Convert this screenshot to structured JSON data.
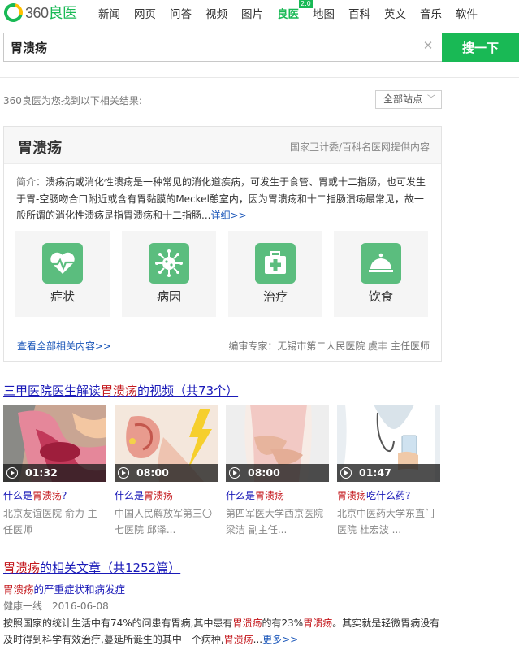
{
  "header": {
    "logo": {
      "num": "360",
      "text": "良医"
    },
    "nav": [
      {
        "label": "新闻",
        "active": false
      },
      {
        "label": "网页",
        "active": false
      },
      {
        "label": "问答",
        "active": false
      },
      {
        "label": "视频",
        "active": false
      },
      {
        "label": "图片",
        "active": false
      },
      {
        "label": "良医",
        "active": true,
        "badge": "2.0"
      },
      {
        "label": "地图",
        "active": false
      },
      {
        "label": "百科",
        "active": false
      },
      {
        "label": "英文",
        "active": false
      },
      {
        "label": "音乐",
        "active": false
      },
      {
        "label": "软件",
        "active": false
      }
    ],
    "search": {
      "value": "胃溃疡",
      "button": "搜一下",
      "clear_icon": "close-icon"
    }
  },
  "results": {
    "info": "360良医为您找到以下相关结果:",
    "site_filter": "全部站点",
    "brand_color": "#19b955"
  },
  "card": {
    "title": "胃溃疡",
    "source": "国家卫计委/百科名医网提供内容",
    "intro_lead": "简介：",
    "intro": "溃疡病或消化性溃疡是一种常见的消化道疾病，可发生于食管、胃或十二指肠，也可发生于胃-空肠吻合口附近或含有胃黏膜的Meckel憩室内，因为胃溃疡和十二指肠溃疡最常见，故一般所谓的消化性溃疡是指胃溃疡和十二指肠...",
    "intro_more": "详细>>",
    "tiles": [
      {
        "label": "症状",
        "icon": "heart-pulse-icon"
      },
      {
        "label": "病因",
        "icon": "virus-icon"
      },
      {
        "label": "治疗",
        "icon": "first-aid-kit-icon"
      },
      {
        "label": "饮食",
        "icon": "food-cloche-icon"
      }
    ],
    "more": "查看全部相关内容>>",
    "experts": "编审专家：无锡市第二人民医院 虞丰 主任医师"
  },
  "videos": {
    "heading_pre": "三甲医院医生解读",
    "heading_hl": "胃溃疡",
    "heading_post": "的视频（共73个）",
    "items": [
      {
        "duration": "01:32",
        "title_pre": "什么是",
        "title_hl": "胃溃疡",
        "title_post": "?",
        "meta": "北京友谊医院 俞力 主任医师"
      },
      {
        "duration": "08:00",
        "title_pre": "什么是",
        "title_hl": "胃溃疡",
        "title_post": "",
        "meta": "中国人民解放军第三〇七医院 邱泽..."
      },
      {
        "duration": "08:00",
        "title_pre": "什么是",
        "title_hl": "胃溃疡",
        "title_post": "",
        "meta": "第四军医大学西京医院 梁洁 副主任..."
      },
      {
        "duration": "01:47",
        "title_pre": "",
        "title_hl": "胃溃疡",
        "title_post": "吃什么药?",
        "meta": "北京中医药大学东直门医院 杜宏波 ..."
      }
    ]
  },
  "articles": {
    "heading_hl": "胃溃疡",
    "heading_post": "的相关文章（共1252篇）",
    "item": {
      "title_hl": "胃溃疡",
      "title_post": "的严重症状和病发症",
      "source": "健康一线",
      "date": "2016-06-08",
      "body_1": "按照国家的统计生活中有74%的问患有胃病,其中患有",
      "body_hl_1": "胃溃疡",
      "body_2": "的有23%",
      "body_hl_2": "胃溃疡",
      "body_3": "。其实就是轻微胃病没有及时得到科学有效治疗,蔓延所诞生的其中一个病种,",
      "body_hl_3": "胃溃疡",
      "body_4": "...",
      "more": "更多>>"
    }
  }
}
